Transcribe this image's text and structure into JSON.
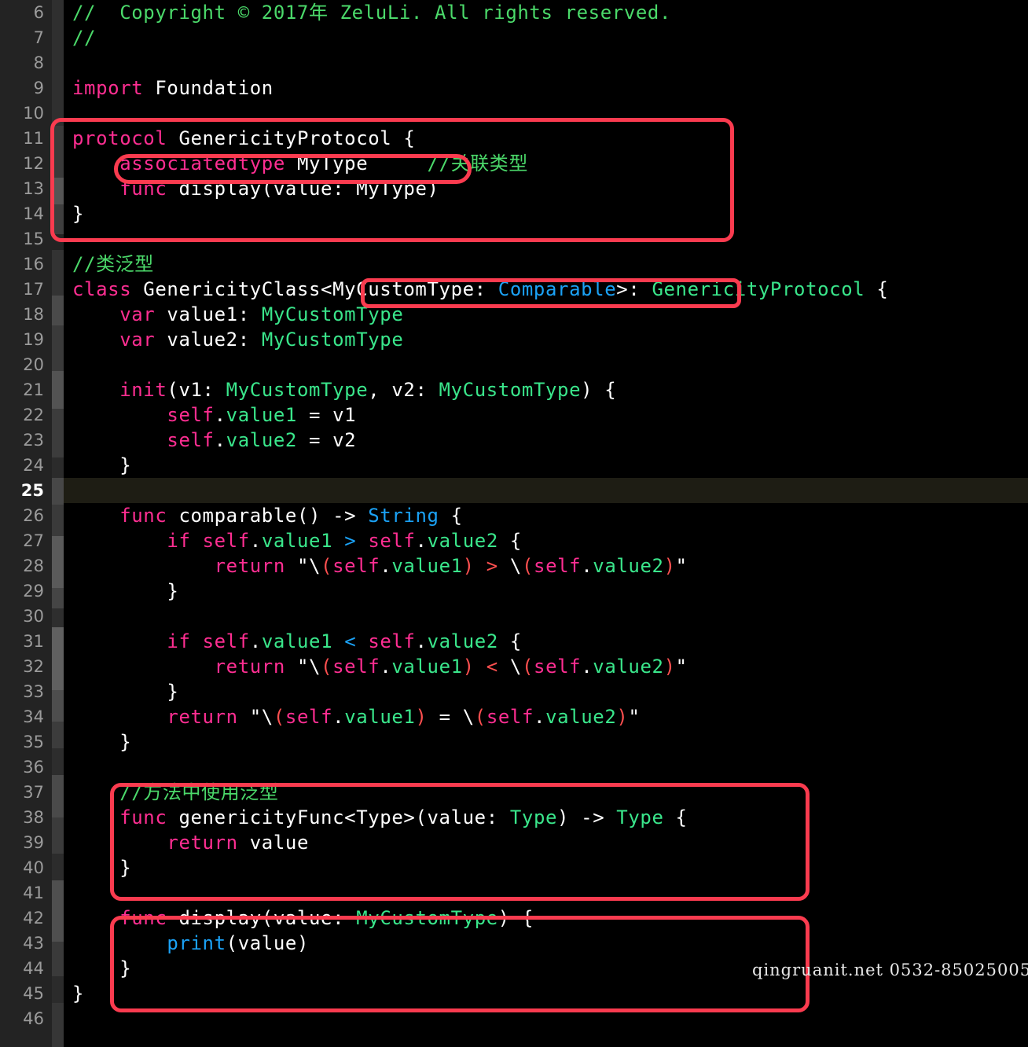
{
  "editor": {
    "language": "Swift",
    "first_visible_line": 6,
    "last_visible_line": 46,
    "current_line": 25,
    "line_height_px": 32,
    "colors": {
      "background": "#000000",
      "gutter_background": "#232323",
      "strip_background": "#2b2b2b",
      "current_line_background": "#1e1d14",
      "line_number": "#9b9b9b",
      "line_number_current": "#ffffff",
      "annotation_red": "#fa3b4f",
      "keyword_pink": "#ff2e92",
      "comment_green": "#4bd96a",
      "type_green": "#3ae68b",
      "builtin_blue": "#1ba2f6",
      "string_red": "#fc4f4f",
      "plain_white": "#ffffff"
    }
  },
  "line_numbers": [
    6,
    7,
    8,
    9,
    10,
    11,
    12,
    13,
    14,
    15,
    16,
    17,
    18,
    19,
    20,
    21,
    22,
    23,
    24,
    25,
    26,
    27,
    28,
    29,
    30,
    31,
    32,
    33,
    34,
    35,
    36,
    37,
    38,
    39,
    40,
    41,
    42,
    43,
    44,
    45,
    46
  ],
  "code_lines": [
    {
      "n": 6,
      "text": "//  Copyright © 2017年 ZeluLi. All rights reserved."
    },
    {
      "n": 7,
      "text": "//"
    },
    {
      "n": 8,
      "text": ""
    },
    {
      "n": 9,
      "text": "import Foundation"
    },
    {
      "n": 10,
      "text": ""
    },
    {
      "n": 11,
      "text": "protocol GenericityProtocol {"
    },
    {
      "n": 12,
      "text": "    associatedtype MyType     //关联类型"
    },
    {
      "n": 13,
      "text": "    func display(value: MyType)"
    },
    {
      "n": 14,
      "text": "}"
    },
    {
      "n": 15,
      "text": ""
    },
    {
      "n": 16,
      "text": "//类泛型"
    },
    {
      "n": 17,
      "text": "class GenericityClass<MyCustomType: Comparable>: GenericityProtocol {"
    },
    {
      "n": 18,
      "text": "    var value1: MyCustomType"
    },
    {
      "n": 19,
      "text": "    var value2: MyCustomType"
    },
    {
      "n": 20,
      "text": ""
    },
    {
      "n": 21,
      "text": "    init(v1: MyCustomType, v2: MyCustomType) {"
    },
    {
      "n": 22,
      "text": "        self.value1 = v1"
    },
    {
      "n": 23,
      "text": "        self.value2 = v2"
    },
    {
      "n": 24,
      "text": "    }"
    },
    {
      "n": 25,
      "text": ""
    },
    {
      "n": 26,
      "text": "    func comparable() -> String {"
    },
    {
      "n": 27,
      "text": "        if self.value1 > self.value2 {"
    },
    {
      "n": 28,
      "text": "            return \"\\(self.value1) > \\(self.value2)\""
    },
    {
      "n": 29,
      "text": "        }"
    },
    {
      "n": 30,
      "text": ""
    },
    {
      "n": 31,
      "text": "        if self.value1 < self.value2 {"
    },
    {
      "n": 32,
      "text": "            return \"\\(self.value1) < \\(self.value2)\""
    },
    {
      "n": 33,
      "text": "        }"
    },
    {
      "n": 34,
      "text": "        return \"\\(self.value1) = \\(self.value2)\""
    },
    {
      "n": 35,
      "text": "    }"
    },
    {
      "n": 36,
      "text": ""
    },
    {
      "n": 37,
      "text": "    //方法中使用泛型"
    },
    {
      "n": 38,
      "text": "    func genericityFunc<Type>(value: Type) -> Type {"
    },
    {
      "n": 39,
      "text": "        return value"
    },
    {
      "n": 40,
      "text": "    }"
    },
    {
      "n": 41,
      "text": ""
    },
    {
      "n": 42,
      "text": "    func display(value: MyCustomType) {"
    },
    {
      "n": 43,
      "text": "        print(value)"
    },
    {
      "n": 44,
      "text": "    }"
    },
    {
      "n": 45,
      "text": "}"
    },
    {
      "n": 46,
      "text": ""
    }
  ],
  "annotations": [
    {
      "name": "protocol-block-box",
      "lines": "11-14"
    },
    {
      "name": "associatedtype-box",
      "lines": "12"
    },
    {
      "name": "generic-constraint-box",
      "lines": "17"
    },
    {
      "name": "generic-function-box",
      "lines": "37-40"
    },
    {
      "name": "display-method-box",
      "lines": "42-44"
    }
  ],
  "watermark": {
    "text": "qingruanit.net 0532-85025005"
  }
}
